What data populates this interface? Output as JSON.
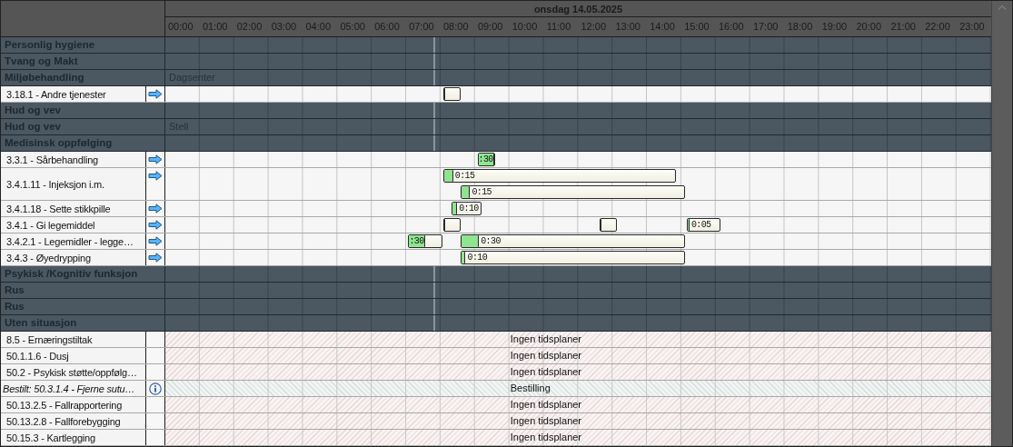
{
  "date": "onsdag 14.05.2025",
  "hours": [
    "00:00",
    "01:00",
    "02:00",
    "03:00",
    "04:00",
    "05:00",
    "06:00",
    "07:00",
    "08:00",
    "09:00",
    "10:00",
    "11:00",
    "12:00",
    "13:00",
    "14:00",
    "15:00",
    "16:00",
    "17:00",
    "18:00",
    "19:00",
    "20:00",
    "21:00",
    "22:00",
    "23:00"
  ],
  "rows": [
    {
      "kind": "group",
      "label": "Personlig hygiene"
    },
    {
      "kind": "group",
      "label": "Tvang og Makt"
    },
    {
      "kind": "group",
      "label": "Miljøbehandling",
      "note": "Dagsenter"
    },
    {
      "kind": "task",
      "label": "3.18.1 - Andre tjenester",
      "lanes": [
        [
          {
            "level": 0.08
          }
        ]
      ]
    },
    {
      "kind": "group",
      "label": "Hud og vev"
    },
    {
      "kind": "group",
      "label": "Hud og vev",
      "note": "Stell"
    },
    {
      "kind": "group",
      "label": "Medisinsk oppfølging"
    },
    {
      "kind": "task",
      "label": "3.3.1 - Sårbehandling",
      "lanes": [
        [
          {
            "level": 1,
            "label": ":30"
          }
        ]
      ]
    },
    {
      "kind": "task",
      "label": "3.4.1.11 - Injeksjon i.m.",
      "lanes": [
        [
          {
            "level": 0.04,
            "label": "0:15"
          }
        ],
        [
          {
            "level": 0.04,
            "label": "0:15"
          }
        ]
      ]
    },
    {
      "kind": "task",
      "label": "3.4.1.18 - Sette stikkpille",
      "lanes": [
        [
          {
            "level": 0.15,
            "label": "0:10"
          }
        ]
      ]
    },
    {
      "kind": "task",
      "label": "3.4.1 - Gi legemiddel",
      "lanes": [
        [
          {
            "level": 0.08
          },
          {
            "level": 0.08
          },
          {
            "level": 0.05,
            "label": "0:05"
          }
        ]
      ]
    },
    {
      "kind": "task",
      "label": "3.4.2.1 - Legemidler - legge…",
      "lanes": [
        [
          {
            "level": 0.5,
            "label": ":30"
          },
          {
            "level": 0.08,
            "label": "0:30"
          }
        ]
      ]
    },
    {
      "kind": "task",
      "label": "3.4.3 - Øyedrypping",
      "lanes": [
        [
          {
            "level": 0.02,
            "label": "0:10"
          }
        ]
      ]
    },
    {
      "kind": "group",
      "label": "Psykisk /Kognitiv funksjon"
    },
    {
      "kind": "group",
      "label": "Rus"
    },
    {
      "kind": "group",
      "label": "Rus"
    },
    {
      "kind": "group",
      "label": "Uten situasjon"
    },
    {
      "kind": "unscheduled",
      "label": "8.5 - Ernæringstiltak",
      "status": "Ingen tidsplaner"
    },
    {
      "kind": "unscheduled",
      "label": "50.1.1.6 - Dusj",
      "status": "Ingen tidsplaner"
    },
    {
      "kind": "unscheduled",
      "label": "50.2 - Psykisk støtte/oppfølg…",
      "status": "Ingen tidsplaner"
    },
    {
      "kind": "order",
      "label": "Bestilt: 50.3.1.4 - Fjerne sutu…",
      "status": "Bestilling"
    },
    {
      "kind": "unscheduled",
      "label": "50.13.2.5 - Fallrapportering",
      "status": "Ingen tidsplaner"
    },
    {
      "kind": "unscheduled",
      "label": "50.13.2.8 - Fallforebygging",
      "status": "Ingen tidsplaner"
    },
    {
      "kind": "unscheduled",
      "label": "50.15.3 - Kartlegging",
      "status": "Ingen tidsplaner"
    }
  ]
}
